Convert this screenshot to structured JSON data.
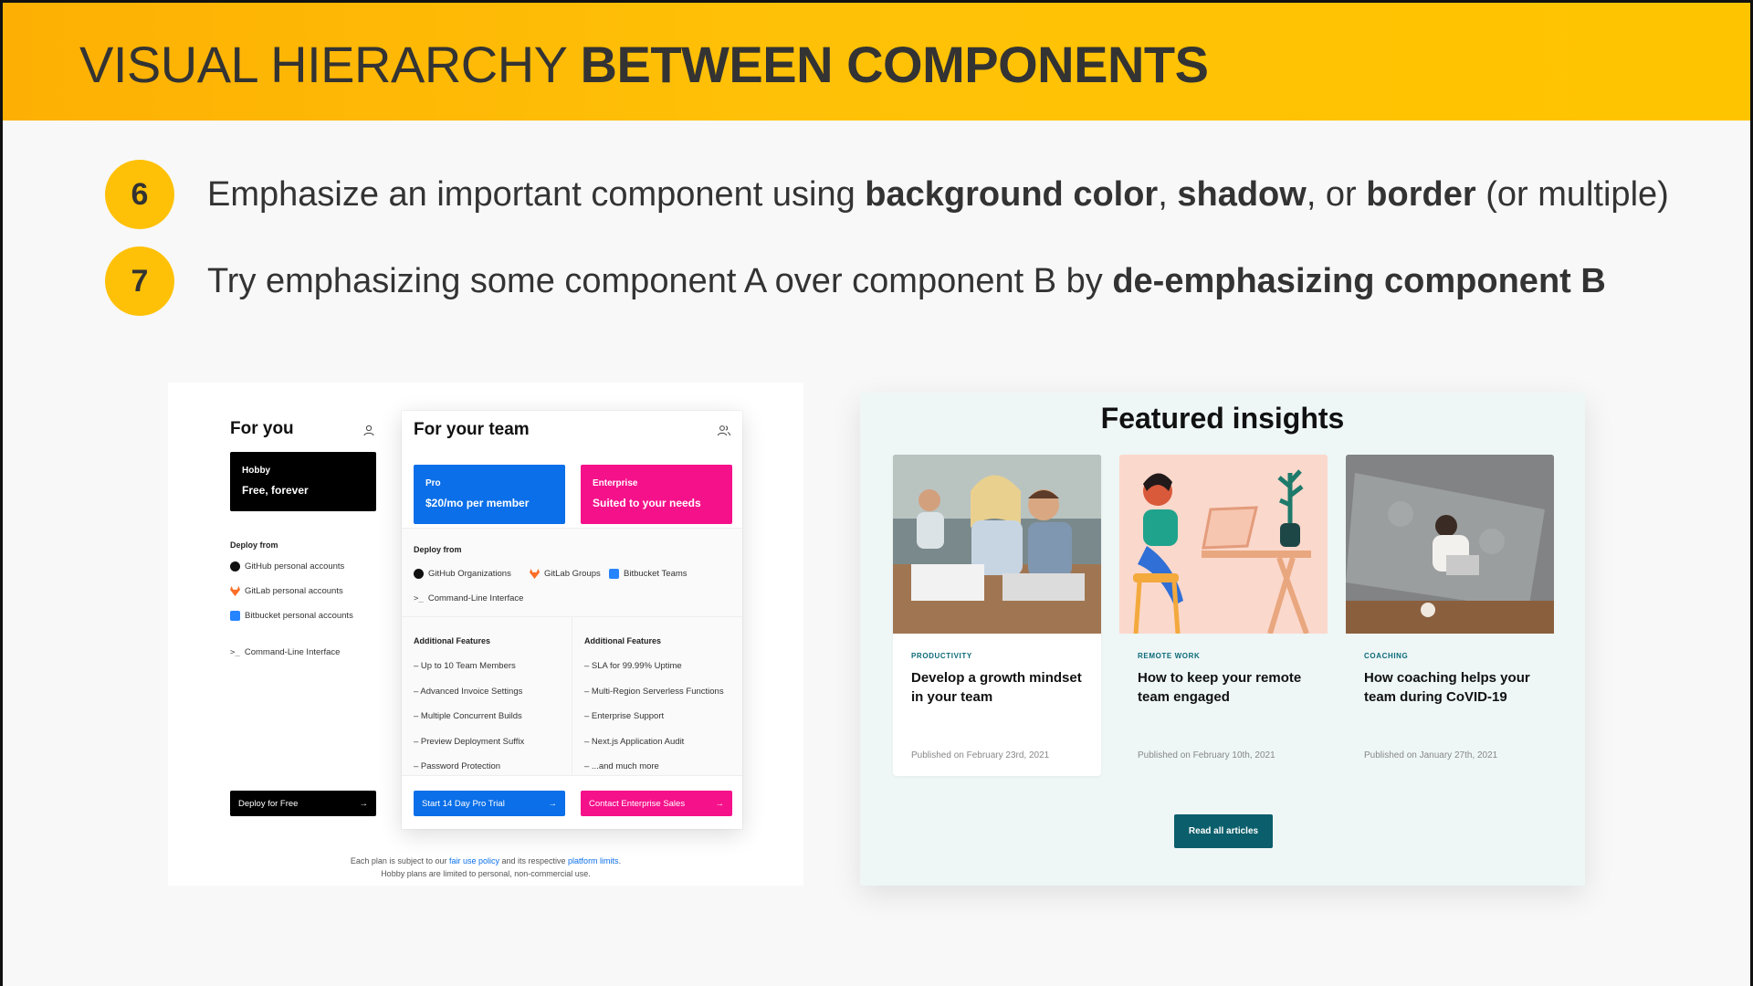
{
  "slide": {
    "title_light": "VISUAL HIERARCHY ",
    "title_bold": "BETWEEN COMPONENTS"
  },
  "rules": [
    {
      "number": "6",
      "parts": [
        "Emphasize an important component using ",
        "background color",
        ", ",
        "shadow",
        ", or ",
        "border",
        " (or multiple)"
      ]
    },
    {
      "number": "7",
      "parts": [
        "Try emphasizing some component A over component B by ",
        "de-emphasizing component B"
      ]
    }
  ],
  "pricing": {
    "you": {
      "title": "For you",
      "plan": {
        "name": "Hobby",
        "price": "Free, forever",
        "color": "#000000"
      },
      "deploy_label": "Deploy from",
      "sources": [
        "GitHub personal accounts",
        "GitLab personal accounts",
        "Bitbucket personal accounts"
      ],
      "cli": "Command-Line Interface",
      "cta": "Deploy for Free"
    },
    "team": {
      "title": "For your team",
      "plans": [
        {
          "name": "Pro",
          "price": "$20/mo per member",
          "color": "#0a6fe8"
        },
        {
          "name": "Enterprise",
          "price": "Suited to your needs",
          "color": "#f5118a"
        }
      ],
      "deploy_label": "Deploy from",
      "sources": [
        "GitHub Organizations",
        "GitLab Groups",
        "Bitbucket Teams"
      ],
      "cli": "Command-Line Interface",
      "features_label_pro": "Additional Features",
      "features_pro": [
        "– Up to 10 Team Members",
        "– Advanced Invoice Settings",
        "– Multiple Concurrent Builds",
        "– Preview Deployment Suffix",
        "– Password Protection"
      ],
      "features_label_ent": "Additional Features",
      "features_ent": [
        "– SLA for 99.99% Uptime",
        "– Multi-Region Serverless Functions",
        "– Enterprise Support",
        "– Next.js Application Audit",
        "– ...and much more"
      ],
      "cta_pro": "Start 14 Day Pro Trial",
      "cta_ent": "Contact Enterprise Sales"
    },
    "footnote": {
      "line1_a": "Each plan is subject to our ",
      "line1_link1": "fair use policy",
      "line1_b": " and its respective ",
      "line1_link2": "platform limits",
      "line1_c": ".",
      "line2": "Hobby plans are limited to personal, non-commercial use."
    }
  },
  "insights": {
    "title": "Featured insights",
    "articles": [
      {
        "category": "PRODUCTIVITY",
        "title": "Develop a growth mindset in your team",
        "date": "Published on February 23rd, 2021"
      },
      {
        "category": "REMOTE WORK",
        "title": "How to keep your remote team engaged",
        "date": "Published on February 10th, 2021"
      },
      {
        "category": "COACHING",
        "title": "How coaching helps your team during CoVID-19",
        "date": "Published on January 27th, 2021"
      }
    ],
    "button": "Read all articles"
  },
  "colors": {
    "accent": "#ffc107",
    "pro": "#0a6fe8",
    "enterprise": "#f5118a",
    "teal": "#0b5e6b"
  }
}
